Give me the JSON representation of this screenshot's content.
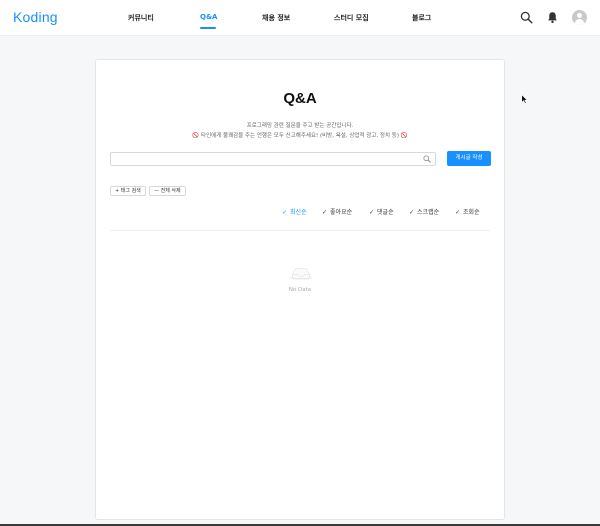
{
  "header": {
    "logo": "Koding",
    "nav": [
      {
        "label": "커뮤니티"
      },
      {
        "label": "Q&A"
      },
      {
        "label": "채용 정보"
      },
      {
        "label": "스터디 모집"
      },
      {
        "label": "블로그"
      }
    ],
    "active_nav": "Q&A",
    "icons": [
      "search-icon",
      "bell-icon",
      "avatar-icon"
    ],
    "accent_color": "#1890ff"
  },
  "main": {
    "title": "Q&A",
    "description_1": "프로그래밍 관련 질문을 주고 받는 공간입니다.",
    "description_2": "🚫 타인에게 불쾌감을 주는 언행은 모두 신고해주세요! (비방, 욕설, 상업적 광고, 정치 등) 🚫",
    "search": {
      "value": "",
      "placeholder": ""
    },
    "write_button": "게시글 작성",
    "tag_search_button": "+ 태그 검색",
    "clear_all_button": "— 전체 삭제",
    "sort_options": [
      {
        "label": "최신순"
      },
      {
        "label": "좋아요순"
      },
      {
        "label": "댓글순"
      },
      {
        "label": "스크랩순"
      },
      {
        "label": "조회순"
      }
    ],
    "active_sort": "최신순",
    "empty_text": "No Data"
  }
}
